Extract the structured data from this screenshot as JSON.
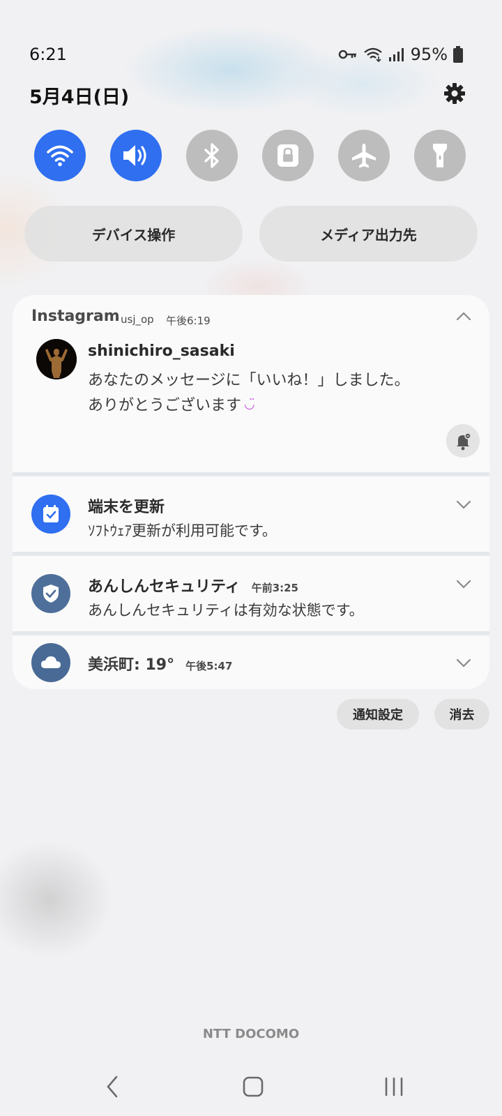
{
  "status_bar": {
    "time": "6:21",
    "battery": "95%",
    "icons": [
      "vpn-key-icon",
      "wifi-icon",
      "signal-icon",
      "battery-icon"
    ]
  },
  "header": {
    "date": "5月4日(日)",
    "settings_icon": "gear-icon"
  },
  "quick_toggles": [
    {
      "name": "wifi",
      "icon": "wifi-icon",
      "state": "on"
    },
    {
      "name": "sound",
      "icon": "volume-icon",
      "state": "on"
    },
    {
      "name": "bluetooth",
      "icon": "bluetooth-icon",
      "state": "off"
    },
    {
      "name": "rotation-lock",
      "icon": "lock-icon",
      "state": "off"
    },
    {
      "name": "airplane",
      "icon": "airplane-icon",
      "state": "off"
    },
    {
      "name": "flashlight",
      "icon": "flashlight-icon",
      "state": "off"
    }
  ],
  "buttons": {
    "device_control": "デバイス操作",
    "media_output": "メディア出力先"
  },
  "notifications": {
    "instagram": {
      "app": "Instagram",
      "account": "usj_op",
      "time": "午後6:19",
      "user": "shinichiro_sasaki",
      "message_line1": "あなたのメッセージに「いいね！」しました。",
      "message_line2": "ありがとうございます",
      "emoji": "◡̈"
    },
    "update": {
      "title": "端末を更新",
      "body": "ｿﾌﾄｳｪｱ更新が利用可能です。"
    },
    "security": {
      "title": "あんしんセキュリティ",
      "time": "午前3:25",
      "body": "あんしんセキュリティは有効な状態です。"
    },
    "weather": {
      "title": "美浜町: 19°",
      "time": "午後5:47"
    }
  },
  "actions": {
    "notification_settings": "通知設定",
    "clear": "消去"
  },
  "carrier": "NTT DOCOMO",
  "colors": {
    "toggle_on": "#2f6ff0",
    "toggle_off": "#bdbdbd",
    "update_icon_bg": "#2f6ff0",
    "security_icon_bg": "#4f6f9b",
    "weather_icon_bg": "#4a6a96"
  }
}
